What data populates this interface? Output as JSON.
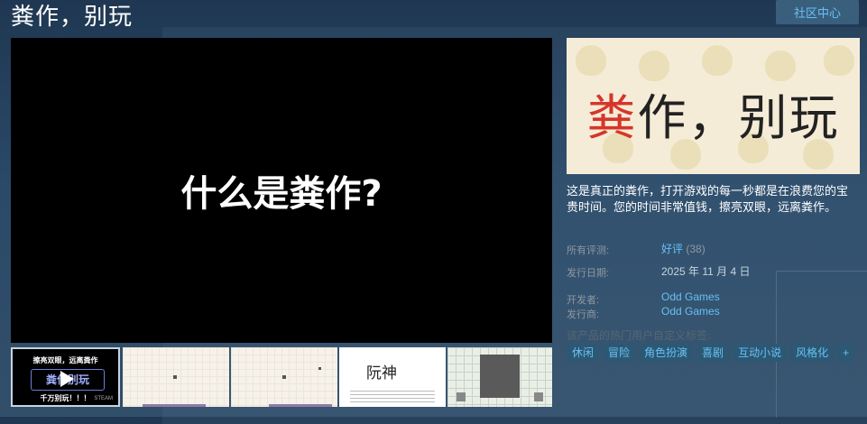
{
  "app": {
    "title": "粪作，别玩",
    "community_hub_label": "社区中心"
  },
  "media": {
    "main_video_text": "什么是粪作?",
    "thumbnails": [
      {
        "top_text": "擦亮双眼，远离粪作",
        "logo_text": "粪作别玩",
        "bottom_text": "千万别玩！！！",
        "badge": "STEAM",
        "icon": "play-icon"
      },
      {
        "kind": "screenshot"
      },
      {
        "kind": "screenshot"
      },
      {
        "kind": "screenshot",
        "label": "阮神"
      },
      {
        "kind": "screenshot"
      }
    ]
  },
  "capsule": {
    "title_first": "粪",
    "title_rest": "作，别玩",
    "accent_color": "#d6362a"
  },
  "description": "这是真正的粪作，打开游戏的每一秒都是在浪费您的宝贵时间。您的时间非常值钱，擦亮双眼，远离粪作。",
  "meta": {
    "reviews_label": "所有评测:",
    "reviews_value": "好评",
    "reviews_count": "(38)",
    "release_label": "发行日期:",
    "release_value": "2025 年 11 月 4 日",
    "developer_label": "开发者:",
    "developer_value": "Odd Games",
    "publisher_label": "发行商:",
    "publisher_value": "Odd Games"
  },
  "tags": {
    "label": "该产品的热门用户自定义标签:",
    "items": [
      "休闲",
      "冒险",
      "角色扮演",
      "喜剧",
      "互动小说",
      "风格化",
      "+"
    ]
  }
}
